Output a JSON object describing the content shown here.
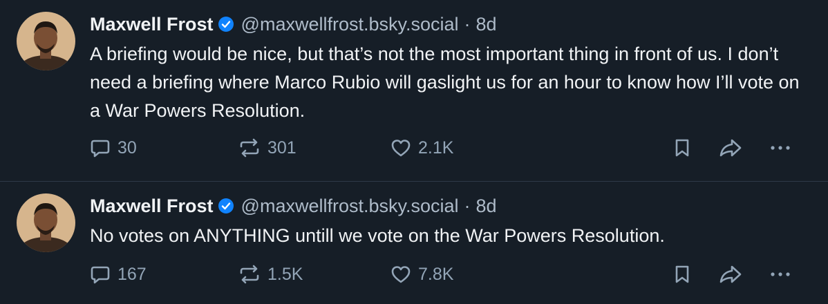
{
  "accent": "#1083fe",
  "posts": [
    {
      "author": "Maxwell Frost",
      "handle": "@maxwellfrost.bsky.social",
      "separator": "·",
      "time": "8d",
      "text": "A briefing would be nice, but that’s not the most important thing in front of us. I don’t need a briefing where Marco Rubio will gaslight us for an hour to know how I’ll vote on a War Powers Resolution.",
      "replies": "30",
      "reposts": "301",
      "likes": "2.1K"
    },
    {
      "author": "Maxwell Frost",
      "handle": "@maxwellfrost.bsky.social",
      "separator": "·",
      "time": "8d",
      "text": "No votes on ANYTHING untill we vote on the War Powers Resolution.",
      "replies": "167",
      "reposts": "1.5K",
      "likes": "7.8K"
    }
  ],
  "icons": {
    "reply": "reply-icon",
    "repost": "repost-icon",
    "like": "heart-icon",
    "bookmark": "bookmark-icon",
    "share": "share-icon",
    "more": "more-icon",
    "verified": "verified-badge-icon"
  }
}
